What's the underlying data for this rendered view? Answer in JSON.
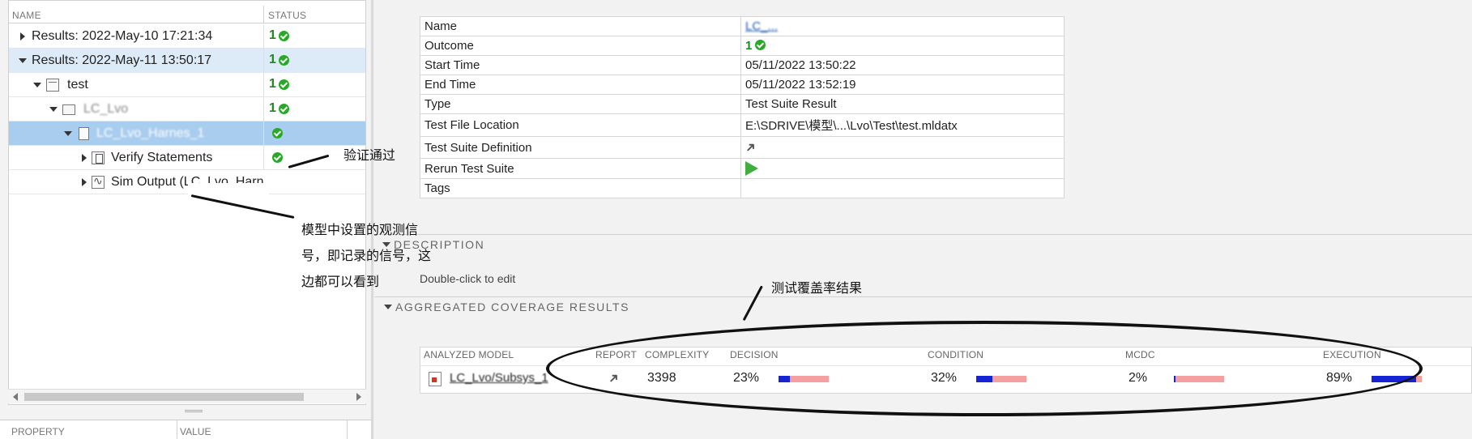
{
  "tree": {
    "col_name": "NAME",
    "col_status": "STATUS",
    "rows": [
      {
        "label": "Results: 2022-May-10 17:21:34",
        "count": "1"
      },
      {
        "label": "Results: 2022-May-11 13:50:17",
        "count": "1"
      },
      {
        "label": "test",
        "count": "1"
      },
      {
        "label": "LC_Lvo",
        "count": "1"
      },
      {
        "label": "LC_Lvo_Harnes_1",
        "count": ""
      },
      {
        "label": "Verify Statements",
        "count": ""
      },
      {
        "label": "Sim Output (LC_Lvo_Harn",
        "count": ""
      }
    ]
  },
  "properties": {
    "col_property": "PROPERTY",
    "col_value": "VALUE"
  },
  "info": {
    "rows": [
      {
        "key": "Name",
        "value": "LC_..."
      },
      {
        "key": "Outcome",
        "value": "1"
      },
      {
        "key": "Start Time",
        "value": "05/11/2022 13:50:22"
      },
      {
        "key": "End Time",
        "value": "05/11/2022 13:52:19"
      },
      {
        "key": "Type",
        "value": "Test Suite Result"
      },
      {
        "key": "Test File Location",
        "value": "E:\\SDRIVE\\模型\\...\\Lvo\\Test\\test.mldatx"
      },
      {
        "key": "Test Suite Definition",
        "value": ""
      },
      {
        "key": "Rerun Test Suite",
        "value": ""
      },
      {
        "key": "Tags",
        "value": ""
      }
    ]
  },
  "description": {
    "heading": "DESCRIPTION",
    "text": "Double-click to edit"
  },
  "coverage": {
    "heading": "AGGREGATED COVERAGE RESULTS",
    "headers": {
      "model": "ANALYZED MODEL",
      "report": "REPORT",
      "complexity": "COMPLEXITY",
      "decision": "DECISION",
      "condition": "CONDITION",
      "mcdc": "MCDC",
      "execution": "EXECUTION"
    },
    "row": {
      "model": "LC_Lvo/Subsys_1",
      "complexity": "3398",
      "decision": "23%",
      "decision_fill": 0.23,
      "condition": "32%",
      "condition_fill": 0.32,
      "mcdc": "2%",
      "mcdc_fill": 0.02,
      "execution": "89%",
      "execution_fill": 0.89
    },
    "colors": {
      "fill": "#1525d4",
      "track": "#f4a0a0"
    }
  },
  "annotations": {
    "verify_passed": "验证通过",
    "sim_output_line1": "模型中设置的观测信",
    "sim_output_line2": "号，即记录的信号，这",
    "sim_output_line3": "边都可以看到",
    "coverage_results": "测试覆盖率结果"
  },
  "icons": [
    "check-icon",
    "folder-icon",
    "document-icon",
    "verify-icon",
    "waveform-icon",
    "arrow-icon",
    "play-icon",
    "model-icon"
  ],
  "colors": {
    "pass_green": "#2aa82a",
    "selection_light": "#ddebf8",
    "selection_strong": "#a9cdef",
    "link_blue": "#1a56b0"
  }
}
